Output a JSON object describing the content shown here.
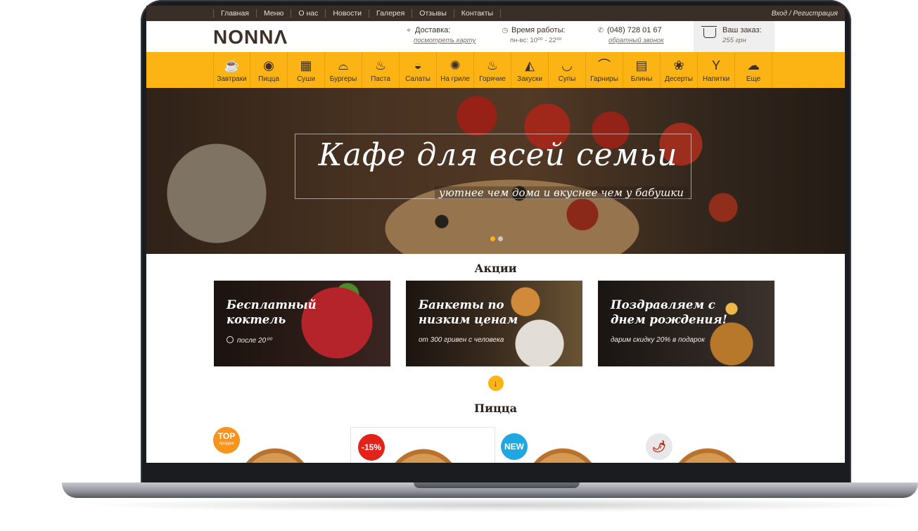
{
  "topnav": {
    "items": [
      "Главная",
      "Меню",
      "О нас",
      "Новости",
      "Галерея",
      "Отзывы",
      "Контакты"
    ],
    "auth": "Вход / Регистрация"
  },
  "header": {
    "logo": "NONNΛ",
    "delivery": {
      "label": "Доставка:",
      "link": "посмотреть карту",
      "icon": "pin-icon"
    },
    "hours": {
      "label": "Время работы:",
      "value": "пн-вс: 10⁰⁰ - 22⁰⁰",
      "icon": "clock-icon"
    },
    "phone": {
      "label": "(048) 728 01 67",
      "link": "обратный звонок",
      "icon": "phone-icon"
    },
    "order": {
      "label": "Ваш заказ:",
      "value": "255 грн",
      "icon": "basket-icon"
    }
  },
  "categories": [
    {
      "label": "Завтраки",
      "icon": "☕",
      "name": "breakfast-icon"
    },
    {
      "label": "Пицца",
      "icon": "◉",
      "name": "pizza-icon"
    },
    {
      "label": "Суши",
      "icon": "▦",
      "name": "sushi-icon"
    },
    {
      "label": "Бургеры",
      "icon": "⌓",
      "name": "burger-icon"
    },
    {
      "label": "Паста",
      "icon": "♨",
      "name": "pasta-icon"
    },
    {
      "label": "Салаты",
      "icon": "◒",
      "name": "salad-icon"
    },
    {
      "label": "На гриле",
      "icon": "✺",
      "name": "grill-icon"
    },
    {
      "label": "Горячие",
      "icon": "♨",
      "name": "hot-dish-icon"
    },
    {
      "label": "Закуски",
      "icon": "◭",
      "name": "snacks-icon"
    },
    {
      "label": "Супы",
      "icon": "◡",
      "name": "soup-icon"
    },
    {
      "label": "Гарниры",
      "icon": "⌒",
      "name": "side-dish-icon"
    },
    {
      "label": "Блины",
      "icon": "▤",
      "name": "pancakes-icon"
    },
    {
      "label": "Десерты",
      "icon": "❀",
      "name": "dessert-icon"
    },
    {
      "label": "Напитки",
      "icon": "Y",
      "name": "drinks-icon"
    },
    {
      "label": "Еще",
      "icon": "☁",
      "name": "more-icon"
    }
  ],
  "hero": {
    "title": "Кафе для всей семьи",
    "subtitle": "уютнее чем дома и вкуснее чем у бабушки"
  },
  "promos": {
    "title": "Акции",
    "cards": [
      {
        "title": "Бесплатный коктель",
        "subtitle": "после 20⁰⁰"
      },
      {
        "title": "Банкеты по низким ценам",
        "subtitle": "от 300 гривен с человека"
      },
      {
        "title": "Поздравляем с днем рождения!",
        "subtitle": "дарим скидку 20% в подарок"
      }
    ]
  },
  "pizza": {
    "title": "Пицца",
    "badges": [
      {
        "text": "TOP",
        "sub": "продаж",
        "color": "#f7941d"
      },
      {
        "text": "-15%",
        "sub": "",
        "color": "#e2231a"
      },
      {
        "text": "NEW",
        "sub": "",
        "color": "#1ea7e1"
      },
      {
        "text": "🌶",
        "sub": "",
        "color": "#e8e8e8"
      }
    ]
  },
  "colors": {
    "accent": "#fcb415",
    "dark": "#3a2e29"
  }
}
